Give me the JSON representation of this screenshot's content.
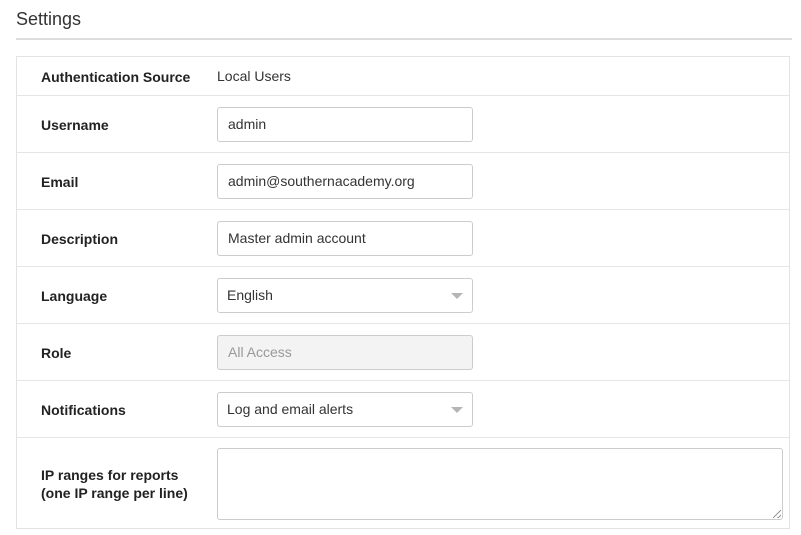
{
  "header": {
    "title": "Settings"
  },
  "form": {
    "auth_source": {
      "label": "Authentication Source",
      "value": "Local Users"
    },
    "username": {
      "label": "Username",
      "value": "admin"
    },
    "email": {
      "label": "Email",
      "value": "admin@southernacademy.org"
    },
    "description": {
      "label": "Description",
      "value": "Master admin account"
    },
    "language": {
      "label": "Language",
      "selected": "English"
    },
    "role": {
      "label": "Role",
      "value": "All Access",
      "disabled": true
    },
    "notifications": {
      "label": "Notifications",
      "selected": "Log and email alerts"
    },
    "ip_ranges": {
      "label_line1": "IP ranges for reports",
      "label_line2": "(one IP range per line)",
      "value": ""
    }
  },
  "icons": {
    "dropdown": "chevron-down-icon",
    "resize": "resize-grip-icon"
  },
  "colors": {
    "border": "#cccccc",
    "row_divider": "#e6e6e6",
    "disabled_bg": "#f3f3f3",
    "caret": "#b5b5b5"
  }
}
